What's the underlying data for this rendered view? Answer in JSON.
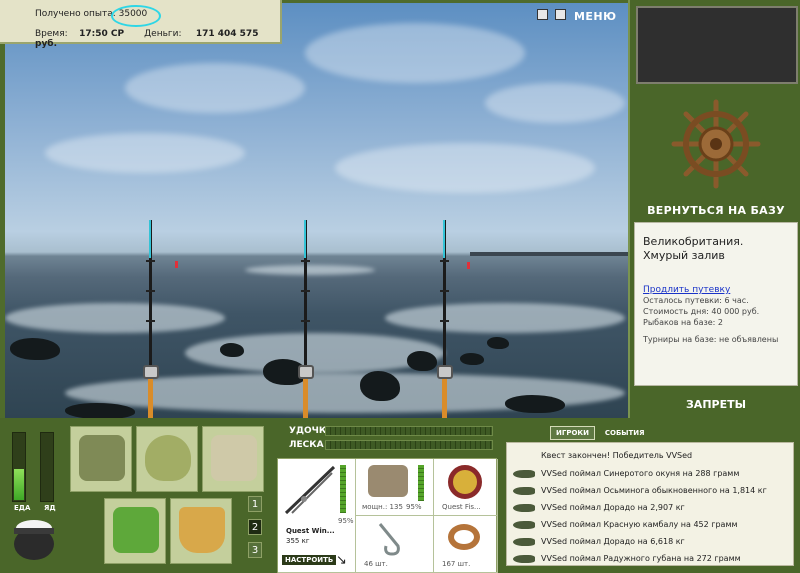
{
  "header": {
    "exp_label": "Получено опыта:",
    "exp_value": "35000",
    "time_label": "Время:",
    "time_value": "17:50 СР",
    "money_label": "Деньги:",
    "money_value": "171 404 575 руб."
  },
  "top_controls": {
    "menu_label": "МЕНЮ"
  },
  "right_panel": {
    "return_label": "ВЕРНУТЬСЯ НА БАЗУ",
    "location": "Великобритания. Хмурый залив",
    "extend_link": "Продлить путевку",
    "trip_left": "Осталось путевки: 6 час.",
    "day_cost": "Стоимость дня: 40 000 руб.",
    "fishers": "Рыбаков на базе: 2",
    "tournaments": "Турниры на базе: не объявлены",
    "bans_label": "ЗАПРЕТЫ"
  },
  "status_meters": {
    "food_label": "ЕДА",
    "poison_label": "ЯД",
    "food_level": 0.45,
    "poison_level": 0.0
  },
  "pager": [
    "1",
    "2",
    "3"
  ],
  "tackle": {
    "rod_label": "УДОЧКА",
    "line_label": "ЛЕСКА",
    "rod_name": "Quest Win...",
    "rod_weight": "355 кг",
    "rod_percent": "95%",
    "setup_label": "НАСТРОИТЬ",
    "reel_power": "мощн.: 135",
    "reel_percent": "95%",
    "line_name": "Quest Fis...",
    "hook_count": "46 шт.",
    "bait_count": "167 шт."
  },
  "events": {
    "tab_players": "ИГРОКИ",
    "tab_events": "СОБЫТИЯ",
    "quest_line": "Квест закончен! Победитель VVSed",
    "catches": [
      "VVSed поймал Синеротого окуня на 288 грамм",
      "VVSed поймал Осьминога обыкновенного на 1,814 кг",
      "VVSed поймал Дорадо на 2,907 кг",
      "VVSed поймал Красную камбалу на 452 грамм",
      "VVSed поймал Дорадо на 6,618 кг",
      "VVSed поймал Радужного губана на 272 грамм"
    ]
  },
  "colors": {
    "ui_green": "#4a6629",
    "panel_light": "#e4e3c8",
    "highlight_cyan": "#2ed6e6",
    "link_blue": "#1a33c8"
  }
}
